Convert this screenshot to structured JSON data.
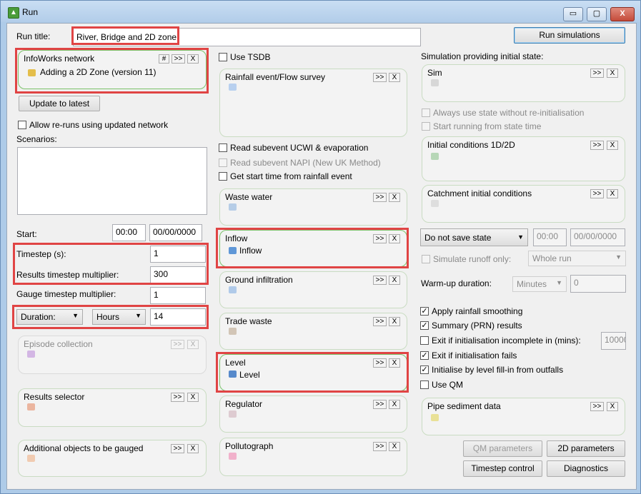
{
  "window": {
    "title": "Run",
    "minimize": "▭",
    "maximize": "▢",
    "close": "X"
  },
  "run_title": {
    "label": "Run title:",
    "value": "River, Bridge and 2D zone"
  },
  "run_simulations": "Run simulations",
  "network": {
    "title": "InfoWorks network",
    "hash": "#",
    "more": ">>",
    "x": "X",
    "item": "Adding a 2D Zone (version 11)"
  },
  "update_latest": "Update to latest",
  "allow_reruns": "Allow re-runs using updated network",
  "scenarios_label": "Scenarios:",
  "start": {
    "label": "Start:",
    "time": "00:00",
    "date": "00/00/0000"
  },
  "timestep": {
    "label": "Timestep (s):",
    "value": "1"
  },
  "results_mult": {
    "label": "Results timestep multiplier:",
    "value": "300"
  },
  "gauge_mult": {
    "label": "Gauge timestep multiplier:",
    "value": "1"
  },
  "duration": {
    "type": "Duration:",
    "unit": "Hours",
    "value": "14"
  },
  "panels": {
    "episode": {
      "title": "Episode collection",
      "more": ">>",
      "x": "X"
    },
    "results_selector": {
      "title": "Results selector",
      "more": ">>",
      "x": "X"
    },
    "additional": {
      "title": "Additional objects to be gauged",
      "more": ">>",
      "x": "X"
    },
    "rainfall": {
      "title": "Rainfall event/Flow survey",
      "more": ">>",
      "x": "X"
    },
    "waste": {
      "title": "Waste water",
      "more": ">>",
      "x": "X"
    },
    "inflow": {
      "title": "Inflow",
      "more": ">>",
      "x": "X",
      "item": "Inflow"
    },
    "ground": {
      "title": "Ground infiltration",
      "more": ">>",
      "x": "X"
    },
    "trade": {
      "title": "Trade waste",
      "more": ">>",
      "x": "X"
    },
    "level": {
      "title": "Level",
      "more": ">>",
      "x": "X",
      "item": "Level"
    },
    "regulator": {
      "title": "Regulator",
      "more": ">>",
      "x": "X"
    },
    "pollutograph": {
      "title": "Pollutograph",
      "more": ">>",
      "x": "X"
    },
    "sim": {
      "title": "Sim",
      "more": ">>",
      "x": "X"
    },
    "initial": {
      "title": "Initial conditions 1D/2D",
      "more": ">>",
      "x": "X"
    },
    "catchment": {
      "title": "Catchment initial conditions",
      "more": ">>",
      "x": "X"
    },
    "sediment": {
      "title": "Pipe sediment data",
      "more": ">>",
      "x": "X"
    }
  },
  "use_tsdb": "Use TSDB",
  "read_ucwi": "Read subevent UCWI & evaporation",
  "read_napi": "Read subevent NAPI (New UK Method)",
  "get_start": "Get start time from rainfall event",
  "sim_initial_label": "Simulation providing initial state:",
  "always_use_state": "Always use state without re-initialisation",
  "start_running": "Start running from state time",
  "save_state": {
    "value": "Do not save state",
    "time": "00:00",
    "date": "00/00/0000"
  },
  "simulate_runoff": {
    "label": "Simulate runoff only:",
    "value": "Whole run"
  },
  "warmup": {
    "label": "Warm-up duration:",
    "unit": "Minutes",
    "value": "0"
  },
  "options": {
    "rainfall_smoothing": "Apply rainfall smoothing",
    "summary_prn": "Summary (PRN) results",
    "exit_incomplete": "Exit if initialisation incomplete in (mins):",
    "exit_incomplete_value": "10000",
    "exit_fails": "Exit if initialisation fails",
    "level_fill": "Initialise by level fill-in from outfalls",
    "use_qm": "Use QM"
  },
  "buttons": {
    "qm": "QM parameters",
    "twod": "2D parameters",
    "timestep": "Timestep control",
    "diagnostics": "Diagnostics"
  }
}
